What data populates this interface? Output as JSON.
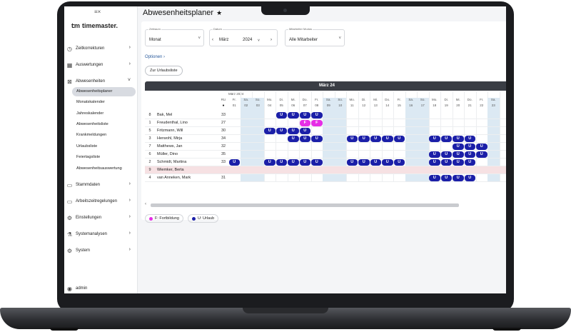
{
  "app": {
    "logo_mark": "t:m",
    "logo_text": "timemaster."
  },
  "sidebar": {
    "items": [
      {
        "label": "Zeitkorrekturen",
        "icon": "clock-icon"
      },
      {
        "label": "Auswertungen",
        "icon": "chart-icon"
      },
      {
        "label": "Abwesenheiten",
        "icon": "calendar-x-icon"
      },
      {
        "label": "Stammdaten",
        "icon": "folder-icon"
      },
      {
        "label": "Arbeitszeitregelungen",
        "icon": "folder-clock-icon"
      },
      {
        "label": "Einstellungen",
        "icon": "gear-icon"
      },
      {
        "label": "Systemanalysen",
        "icon": "analytics-icon"
      },
      {
        "label": "System",
        "icon": "settings-icon"
      }
    ],
    "subitems": [
      "Abwesenheitsplaner",
      "Monatskalender",
      "Jahreskalender",
      "Abwesenheitsliste",
      "Krankmeldungen",
      "Urlaubsliste",
      "Feiertagsliste",
      "Abwesenheitsauswertung"
    ],
    "active_subitem": "Abwesenheitsplaner",
    "user": "admin"
  },
  "page": {
    "title": "Abwesenheitsplaner"
  },
  "filters": {
    "zeitraum": {
      "label": "Zeitraum",
      "value": "Monat"
    },
    "datum": {
      "label": "Datum",
      "month": "März",
      "year": "2024"
    },
    "modus": {
      "label": "Mitarbeiter Modus",
      "value": "Alle Mitarbeiter"
    }
  },
  "options_link": "Optionen",
  "btn_urlaubsliste": "Zur Urlaubsliste",
  "planner": {
    "month_header": "März 24",
    "month_small": "März 2024",
    "ru_header": "RU",
    "days": [
      {
        "dow": "Fr.",
        "d": "01"
      },
      {
        "dow": "Sa.",
        "d": "02"
      },
      {
        "dow": "So.",
        "d": "03"
      },
      {
        "dow": "Mo.",
        "d": "04"
      },
      {
        "dow": "Di.",
        "d": "05"
      },
      {
        "dow": "Mi.",
        "d": "06"
      },
      {
        "dow": "Do.",
        "d": "07"
      },
      {
        "dow": "Fr.",
        "d": "08"
      },
      {
        "dow": "Sa.",
        "d": "09"
      },
      {
        "dow": "So.",
        "d": "10"
      },
      {
        "dow": "Mo.",
        "d": "11"
      },
      {
        "dow": "Di.",
        "d": "12"
      },
      {
        "dow": "Mi.",
        "d": "13"
      },
      {
        "dow": "Do.",
        "d": "14"
      },
      {
        "dow": "Fr.",
        "d": "15"
      },
      {
        "dow": "Sa.",
        "d": "16"
      },
      {
        "dow": "So.",
        "d": "17"
      },
      {
        "dow": "Mo.",
        "d": "18"
      },
      {
        "dow": "Di.",
        "d": "19"
      },
      {
        "dow": "Mi.",
        "d": "20"
      },
      {
        "dow": "Do.",
        "d": "21"
      },
      {
        "dow": "Fr.",
        "d": "22"
      },
      {
        "dow": "Sa.",
        "d": "23"
      }
    ],
    "weekend_days": [
      "02",
      "03",
      "09",
      "10",
      "16",
      "17",
      "23"
    ],
    "rows": [
      {
        "num": "8",
        "name": "Bak, Mel",
        "ru": "33",
        "u": [
          "05",
          "06",
          "07",
          "08"
        ],
        "f": []
      },
      {
        "num": "1",
        "name": "Freudenthal, Lino",
        "ru": "27",
        "u": [],
        "f": [
          "07",
          "08"
        ]
      },
      {
        "num": "5",
        "name": "Fritzmann, Will",
        "ru": "30",
        "u": [
          "04",
          "05",
          "06",
          "07"
        ],
        "f": []
      },
      {
        "num": "3",
        "name": "Herwohl, Mirja",
        "ru": "34",
        "u": [
          "06",
          "07",
          "08",
          "11",
          "12",
          "13",
          "14",
          "15",
          "18",
          "19",
          "20",
          "21"
        ],
        "f": []
      },
      {
        "num": "7",
        "name": "Matthews, Jan",
        "ru": "32",
        "u": [
          "20",
          "21",
          "22"
        ],
        "f": []
      },
      {
        "num": "6",
        "name": "Müller, Dino",
        "ru": "35",
        "u": [
          "18",
          "19",
          "20",
          "21",
          "22"
        ],
        "f": []
      },
      {
        "num": "2",
        "name": "Schmidt, Martina",
        "ru": "33",
        "u": [
          "01",
          "04",
          "05",
          "06",
          "07",
          "08",
          "11",
          "12",
          "13",
          "14",
          "15",
          "18",
          "19",
          "20",
          "21"
        ],
        "f": []
      },
      {
        "num": "9",
        "name": "Wiemker, Berta",
        "ru": "",
        "u": [],
        "f": [],
        "highlight": true
      },
      {
        "num": "4",
        "name": "van Anneken, Mark",
        "ru": "31",
        "u": [
          "18",
          "19",
          "20",
          "21"
        ],
        "f": []
      }
    ]
  },
  "legend": [
    {
      "label": "F: Fortbildung",
      "color": "#e62ee6"
    },
    {
      "label": "U: Urlaub",
      "color": "#1b1fa8"
    }
  ],
  "colors": {
    "urlaub": "#1b1fa8",
    "fortbildung": "#e62ee6",
    "header": "#3a3d44"
  }
}
